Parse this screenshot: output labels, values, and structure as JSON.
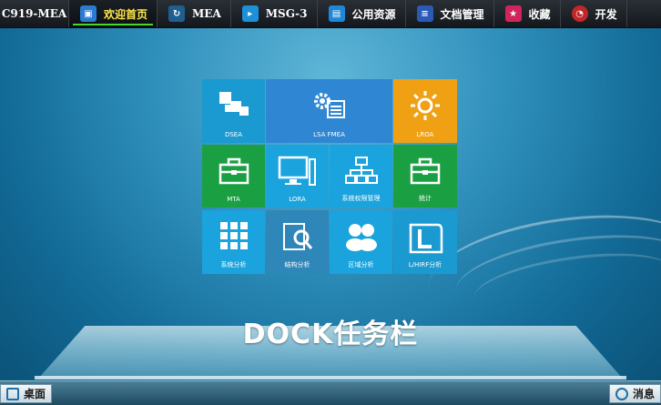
{
  "topbar": {
    "app_title": "C919-MEA",
    "tabs": [
      {
        "label": "欢迎首页",
        "icon": "chat-icon",
        "icon_color": "#2a7bd1",
        "active": true
      },
      {
        "label": "MEA",
        "icon": "refresh-icon",
        "icon_color": "#1f5f8f"
      },
      {
        "label": "MSG-3",
        "icon": "play-icon",
        "icon_color": "#1e90d8"
      },
      {
        "label": "公用资源",
        "icon": "window-icon",
        "icon_color": "#1f87d6"
      },
      {
        "label": "文档管理",
        "icon": "document-icon",
        "icon_color": "#2a5ab5"
      },
      {
        "label": "收藏",
        "icon": "bookmark-icon",
        "icon_color": "#d0245c"
      },
      {
        "label": "开发",
        "icon": "gauge-icon",
        "icon_color": "#c3262a"
      }
    ]
  },
  "tiles": [
    {
      "label": "DSEA",
      "icon": "squares-icon",
      "color": "#1a9ad0"
    },
    {
      "label": "LSA FMEA",
      "icon": "gear-list-icon",
      "color": "#2f86d3"
    },
    {
      "label": "LROA",
      "icon": "sun-icon",
      "color": "#f0a013"
    },
    {
      "label": "MTA",
      "icon": "toolbox-icon",
      "color": "#1a9f43"
    },
    {
      "label": "LORA",
      "icon": "monitor-icon",
      "color": "#1aa3dd"
    },
    {
      "label": "系统权限管理",
      "icon": "org-chart-icon",
      "color": "#1aa3dd"
    },
    {
      "label": "统计",
      "icon": "toolbox-icon",
      "color": "#1a9f43"
    },
    {
      "label": "系统分析",
      "icon": "grid-icon",
      "color": "#1aa3dd"
    },
    {
      "label": "结构分析",
      "icon": "magnifier-icon",
      "color": "#2f86b8"
    },
    {
      "label": "区域分析",
      "icon": "people-icon",
      "color": "#1aa3dd"
    },
    {
      "label": "L/HIRF分析",
      "icon": "letter-l-icon",
      "color": "#1a9ad0"
    }
  ],
  "dock": {
    "title": "DOCK任务栏"
  },
  "bottombar": {
    "desktop_label": "桌面",
    "message_label": "消息"
  }
}
